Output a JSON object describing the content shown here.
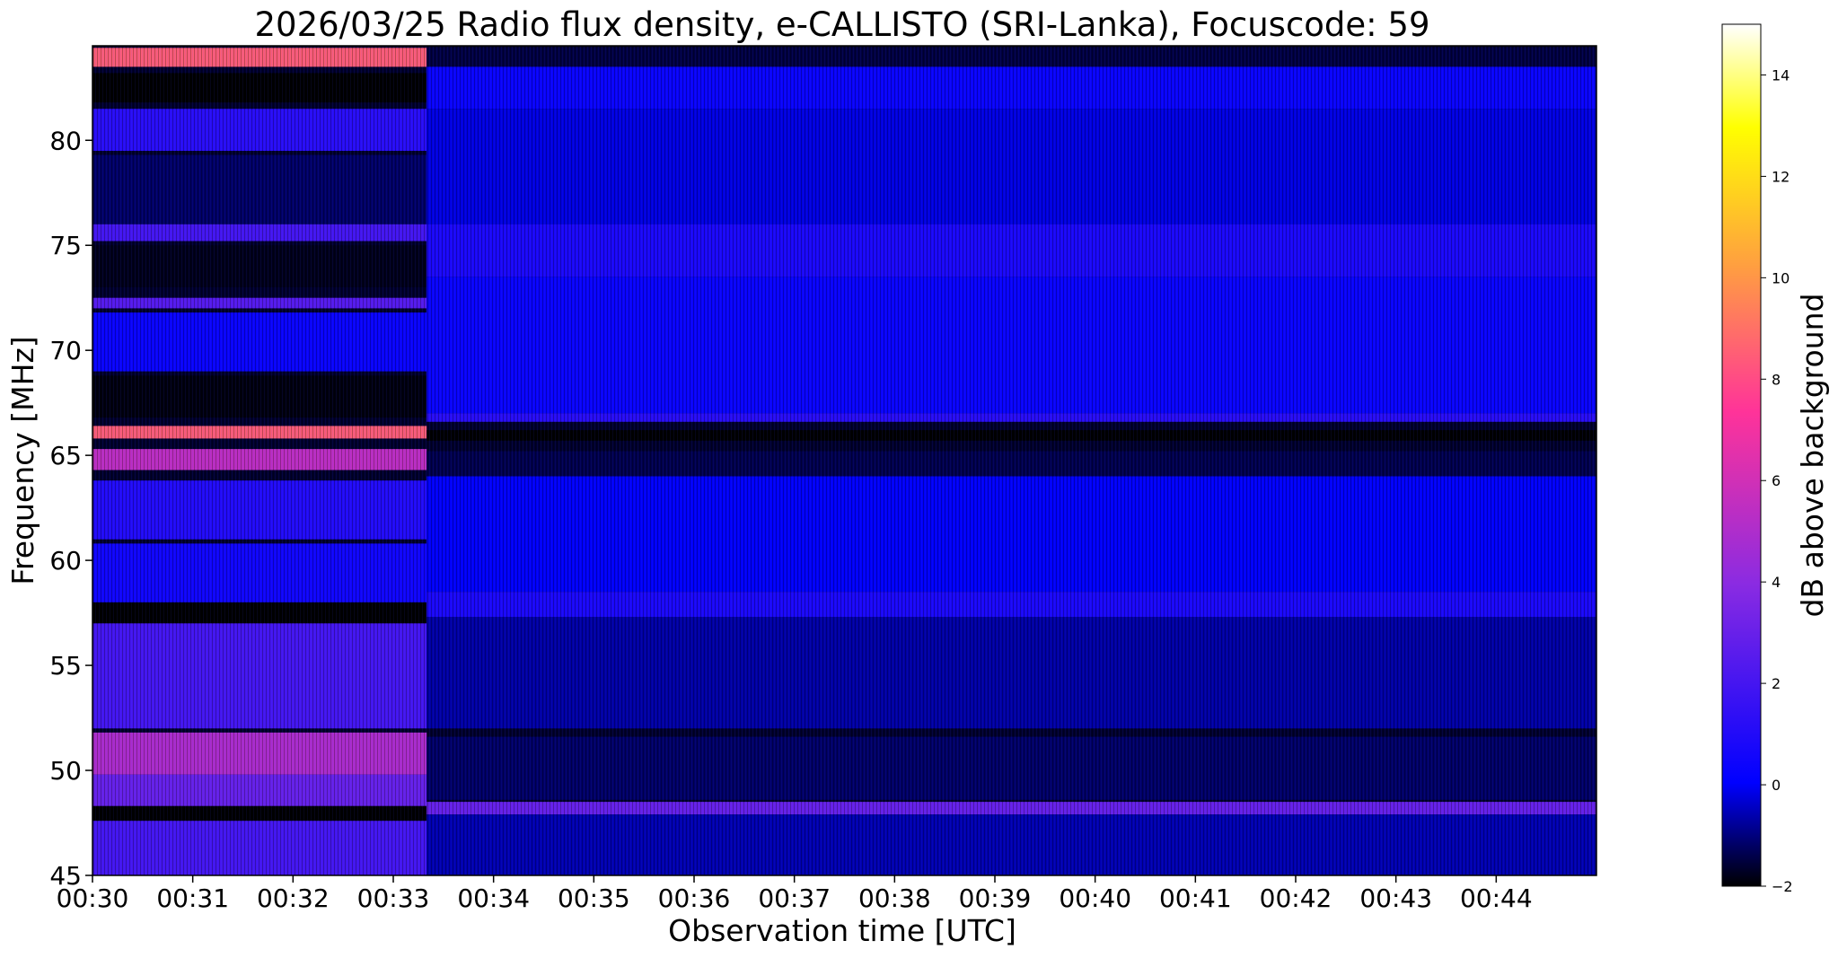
{
  "chart_data": {
    "type": "heatmap",
    "title": "2026/03/25  Radio flux density, e-CALLISTO (SRI-Lanka), Focuscode: 59",
    "xlabel": "Observation time [UTC]",
    "ylabel": "Frequency [MHz]",
    "colorbar_label": "dB above background",
    "x_ticks": [
      "00:30",
      "00:31",
      "00:32",
      "00:33",
      "00:34",
      "00:35",
      "00:36",
      "00:37",
      "00:38",
      "00:39",
      "00:40",
      "00:41",
      "00:42",
      "00:43",
      "00:44"
    ],
    "xlim_minutes": [
      0,
      15
    ],
    "y_ticks": [
      45,
      50,
      55,
      60,
      65,
      70,
      75,
      80
    ],
    "ylim": [
      45,
      84.5
    ],
    "colorbar_ticks": [
      -2,
      0,
      2,
      4,
      6,
      8,
      10,
      12,
      14
    ],
    "clim": [
      -2,
      15
    ],
    "colormap": [
      "#000000",
      "#0000ff",
      "#8a2be2",
      "#ff3399",
      "#ff9f40",
      "#ffff00",
      "#ffffff"
    ],
    "segments": [
      {
        "time_range": [
          "00:30",
          "00:33:20"
        ],
        "bands": [
          {
            "f": [
              83.5,
              84.4
            ],
            "db": 8.5
          },
          {
            "f": [
              81.8,
              83.2
            ],
            "db": -2
          },
          {
            "f": [
              79.5,
              81.5
            ],
            "db": 1.2
          },
          {
            "f": [
              76.0,
              79.3
            ],
            "db": -1.2
          },
          {
            "f": [
              75.2,
              76.0
            ],
            "db": 2.0
          },
          {
            "f": [
              73.0,
              75.0
            ],
            "db": -1.8
          },
          {
            "f": [
              72.0,
              72.5
            ],
            "db": 2.5
          },
          {
            "f": [
              69.0,
              71.8
            ],
            "db": 0.3
          },
          {
            "f": [
              66.8,
              68.8
            ],
            "db": -1.9
          },
          {
            "f": [
              65.8,
              66.4
            ],
            "db": 8.5
          },
          {
            "f": [
              64.3,
              65.3
            ],
            "db": 5.5
          },
          {
            "f": [
              61.0,
              63.8
            ],
            "db": 1.0
          },
          {
            "f": [
              58.0,
              60.8
            ],
            "db": 0.5
          },
          {
            "f": [
              57.0,
              58.0
            ],
            "db": -2
          },
          {
            "f": [
              52.0,
              57.0
            ],
            "db": 2.0
          },
          {
            "f": [
              49.8,
              51.8
            ],
            "db": 5.0
          },
          {
            "f": [
              48.3,
              49.8
            ],
            "db": 3.0
          },
          {
            "f": [
              47.6,
              48.3
            ],
            "db": -2
          },
          {
            "f": [
              45.0,
              47.6
            ],
            "db": 2.0
          }
        ]
      },
      {
        "time_range": [
          "00:33:20",
          "00:45"
        ],
        "bands": [
          {
            "f": [
              83.5,
              84.4
            ],
            "db": -1.5
          },
          {
            "f": [
              81.5,
              83.5
            ],
            "db": 0.3
          },
          {
            "f": [
              76.0,
              81.5
            ],
            "db": -0.2
          },
          {
            "f": [
              73.5,
              76.0
            ],
            "db": 0.8
          },
          {
            "f": [
              67.0,
              73.5
            ],
            "db": 0.3
          },
          {
            "f": [
              66.6,
              67.0
            ],
            "db": 1.2
          },
          {
            "f": [
              65.7,
              66.2
            ],
            "db": -2
          },
          {
            "f": [
              64.0,
              65.2
            ],
            "db": -1.4
          },
          {
            "f": [
              58.5,
              64.0
            ],
            "db": 0.0
          },
          {
            "f": [
              57.3,
              58.5
            ],
            "db": 0.8
          },
          {
            "f": [
              52.0,
              57.3
            ],
            "db": -0.7
          },
          {
            "f": [
              48.6,
              51.6
            ],
            "db": -1.2
          },
          {
            "f": [
              47.9,
              48.5
            ],
            "db": 3.0
          },
          {
            "f": [
              45.0,
              47.9
            ],
            "db": -0.6
          }
        ]
      }
    ]
  }
}
